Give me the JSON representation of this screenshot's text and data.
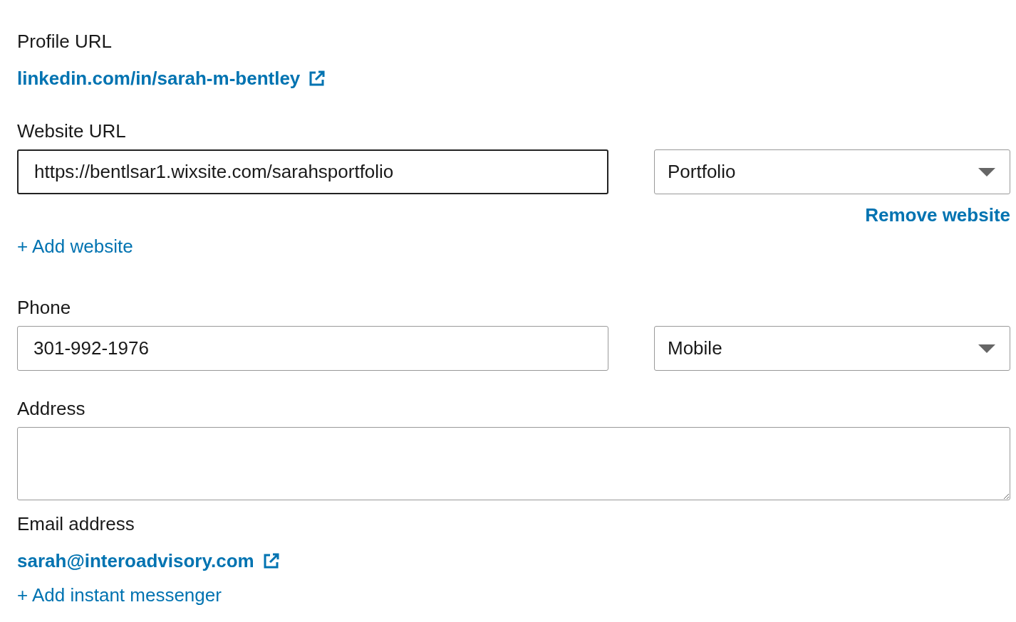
{
  "profile_url": {
    "label": "Profile URL",
    "link": "linkedin.com/in/sarah-m-bentley"
  },
  "website": {
    "label": "Website URL",
    "value": "https://bentlsar1.wixsite.com/sarahsportfolio",
    "focused": true,
    "type": "Portfolio",
    "remove_link": "Remove website"
  },
  "add_website": "+ Add website",
  "phone": {
    "label": "Phone",
    "value": "301-992-1976",
    "focused": false,
    "type": "Mobile"
  },
  "address": {
    "label": "Address"
  },
  "email": {
    "label": "Email address",
    "link": "sarah@interoadvisory.com"
  },
  "add_messenger": "+ Add instant messenger"
}
